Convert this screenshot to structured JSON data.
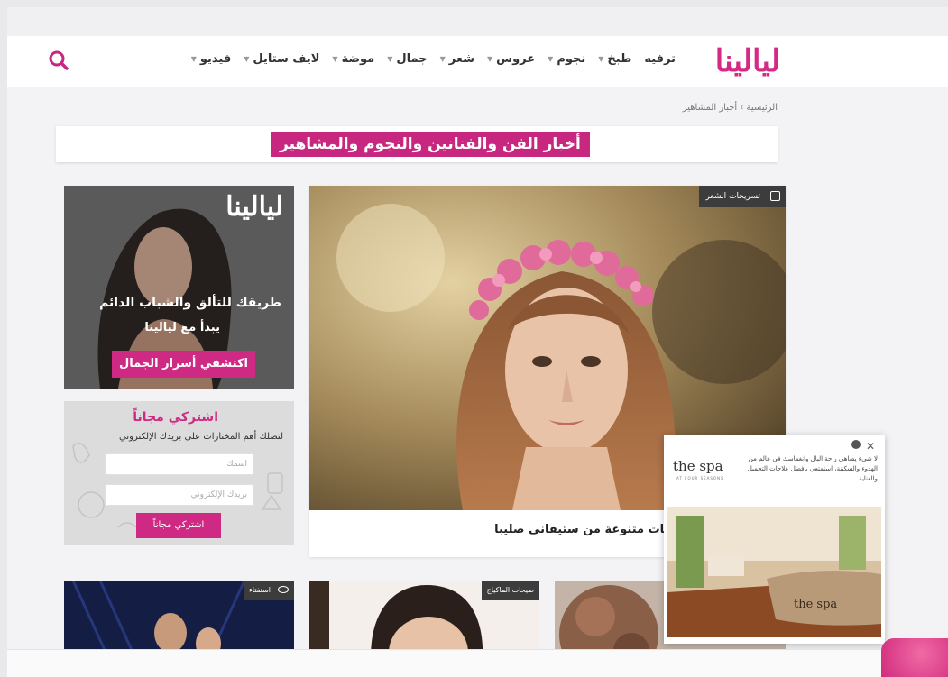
{
  "header": {
    "logo": "ليالينا",
    "nav": [
      {
        "label": "فيديو"
      },
      {
        "label": "لايف ستايل"
      },
      {
        "label": "موضة"
      },
      {
        "label": "جمال"
      },
      {
        "label": "شعر"
      },
      {
        "label": "عروس"
      },
      {
        "label": "نجوم"
      },
      {
        "label": "طبخ"
      },
      {
        "label": "ترفيه"
      }
    ],
    "search_icon": "search-icon"
  },
  "breadcrumb": {
    "home": "الرئيسية",
    "separator": "›",
    "current": "أخبار المشاهير"
  },
  "page_title": "أخبار الفن والفنانين والنجوم والمشاهير",
  "featured": {
    "category": "تسريحات الشعر",
    "caption": "ر: استلهمي تسريحات متنوعة من ستيفاني صليبا"
  },
  "promo": {
    "logo": "ليالينا",
    "line1": "طريقك للتألق والشباب الدائم",
    "line2": "يبدأ مع ليالينا",
    "cta": "اكتشفي أسرار الجمال"
  },
  "newsletter": {
    "title": "اشتركي مجاناً",
    "subtitle": "لتصلك أهم المختارات على بريدك الإلكتروني",
    "name_placeholder": "اسمك",
    "email_placeholder": "بريدك الإلكتروني",
    "button": "اشتركي مجاناً"
  },
  "cards": [
    {
      "badge": "استفتاء",
      "badge_icon": "eye-icon"
    },
    {
      "badge": "صيحات الماكياج"
    },
    {
      "badge": ""
    }
  ],
  "spa_ad": {
    "logo": "the spa",
    "tagline": "AT FOUR SEASONS",
    "text": "لا شيء يضاهي راحة البال وانغماسك في عالم من الهدوء والسكينة، استمتعي بأفضل علاجات التجميل والعناية",
    "close": "✕"
  },
  "colors": {
    "brand": "#d62986",
    "title_bg": "#c8277f",
    "badge_bg": "#3c3c3c"
  }
}
